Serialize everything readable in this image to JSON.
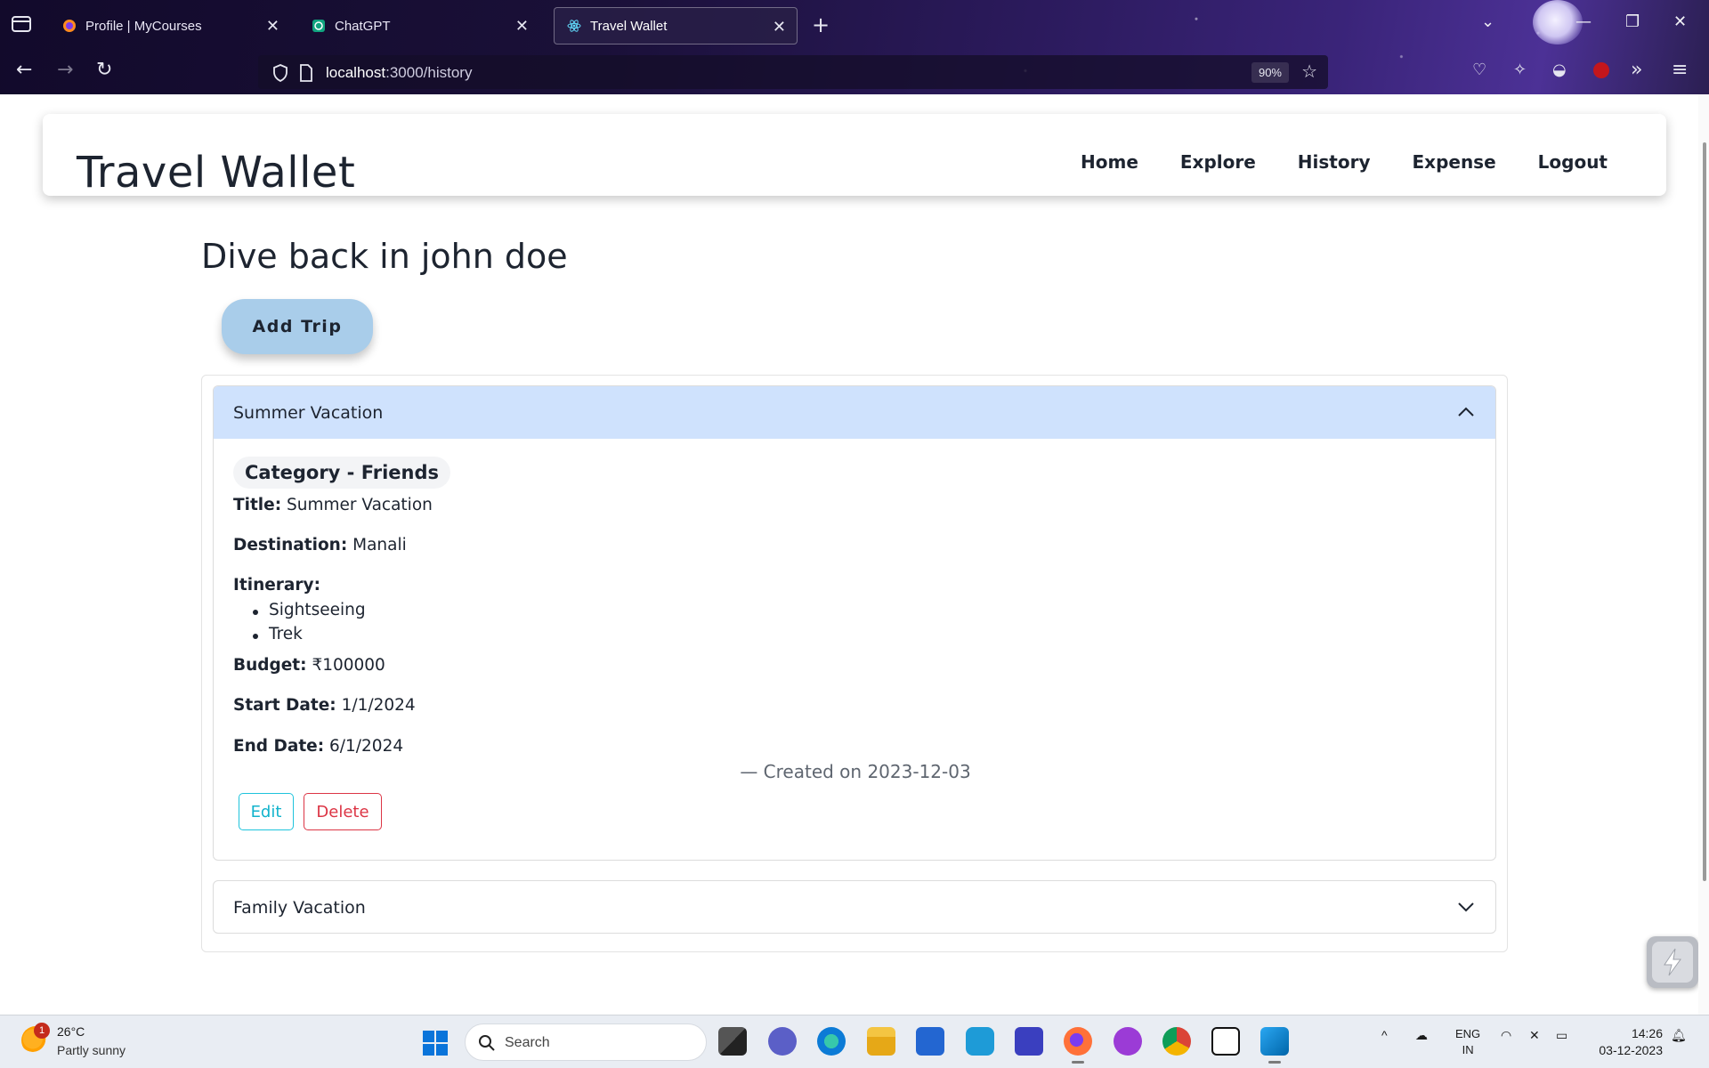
{
  "browser": {
    "tabs": [
      {
        "title": "Profile | MyCourses",
        "icon": "firefox-icon"
      },
      {
        "title": "ChatGPT",
        "icon": "chatgpt-icon"
      },
      {
        "title": "Travel Wallet",
        "icon": "react-icon",
        "active": true
      }
    ],
    "url_host": "localhost",
    "url_rest": ":3000/history",
    "zoom": "90%"
  },
  "app": {
    "brand": "Travel Wallet",
    "nav": [
      "Home",
      "Explore",
      "History",
      "Expense",
      "Logout"
    ],
    "greeting": "Dive back in john doe",
    "add_trip_label": "Add Trip",
    "trips": [
      {
        "name": "Summer Vacation",
        "expanded": true,
        "category": "Category - Friends",
        "title_label": "Title:",
        "title": "Summer Vacation",
        "destination_label": "Destination:",
        "destination": "Manali",
        "itinerary_label": "Itinerary:",
        "itinerary": [
          "Sightseeing",
          "Trek"
        ],
        "budget_label": "Budget:",
        "budget": "₹100000",
        "start_label": "Start Date:",
        "start_date": "1/1/2024",
        "end_label": "End Date:",
        "end_date": "6/1/2024",
        "created": "— Created on 2023-12-03",
        "edit_label": "Edit",
        "delete_label": "Delete"
      },
      {
        "name": "Family Vacation",
        "expanded": false
      }
    ]
  },
  "taskbar": {
    "weather_badge": "1",
    "temp": "26°C",
    "condition": "Partly sunny",
    "search_placeholder": "Search",
    "lang_line1": "ENG",
    "lang_line2": "IN",
    "time": "14:26",
    "date": "03-12-2023"
  },
  "colors": {
    "accordion_header_open": "#cfe2fd",
    "add_trip_bg": "#a9cdea",
    "edit": "#12b3cc",
    "delete": "#dc3545"
  }
}
